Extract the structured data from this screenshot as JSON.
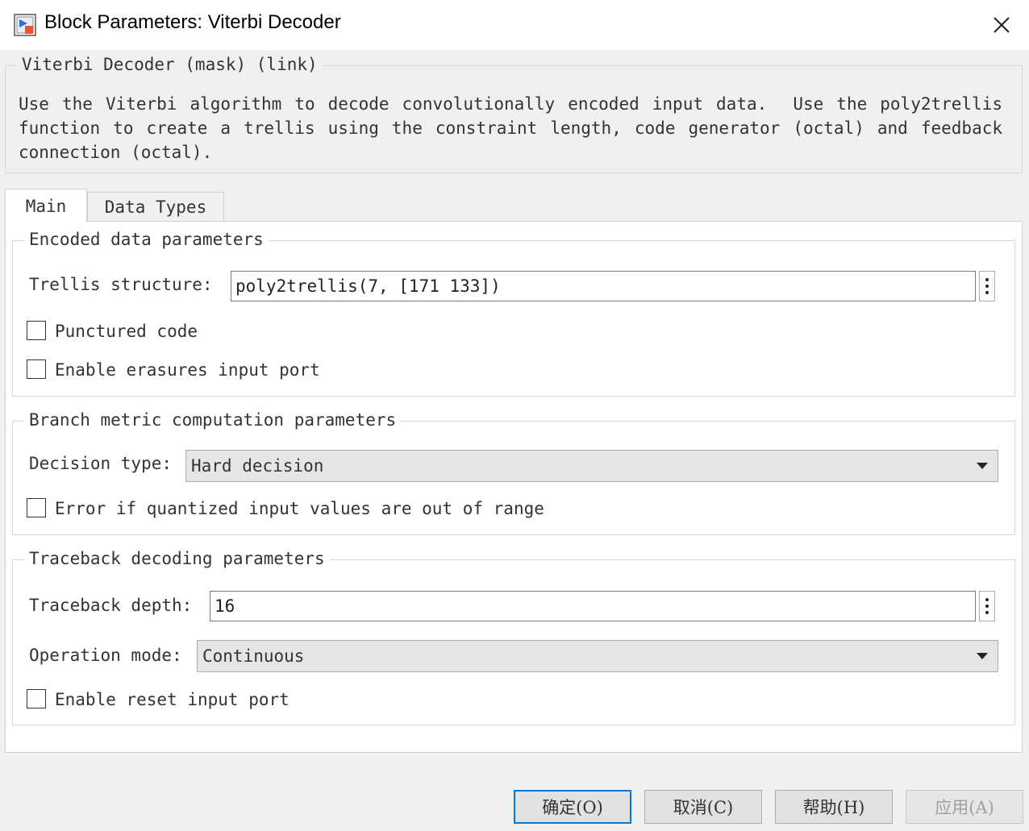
{
  "window": {
    "title": "Block Parameters: Viterbi Decoder",
    "icon": "simulink-block-icon",
    "close_icon": "close-icon"
  },
  "description": {
    "legend": "Viterbi Decoder (mask) (link)",
    "text": "Use the Viterbi algorithm to decode convolutionally encoded input data.  Use the poly2trellis function to create a trellis using the constraint length, code generator (octal) and feedback connection (octal)."
  },
  "tabs": [
    {
      "label": "Main",
      "selected": true
    },
    {
      "label": "Data Types",
      "selected": false
    }
  ],
  "encoded_group": {
    "legend": "Encoded data parameters",
    "trellis_label": "Trellis structure:",
    "trellis_value": "poly2trellis(7, [171 133])",
    "punctured_label": "Punctured code",
    "punctured_checked": false,
    "erasures_label": "Enable erasures input port",
    "erasures_checked": false
  },
  "branch_group": {
    "legend": "Branch metric computation parameters",
    "decision_label": "Decision type:",
    "decision_value": "Hard decision",
    "error_label": "Error if quantized input values are out of range",
    "error_checked": false
  },
  "traceback_group": {
    "legend": "Traceback decoding parameters",
    "depth_label": "Traceback depth:",
    "depth_value": "16",
    "mode_label": "Operation mode:",
    "mode_value": "Continuous",
    "reset_label": "Enable reset input port",
    "reset_checked": false
  },
  "buttons": {
    "ok": "确定(O)",
    "cancel": "取消(C)",
    "help": "帮助(H)",
    "apply": "应用(A)"
  },
  "colors": {
    "accent": "#0078d7",
    "dialog_bg": "#f0f0f0",
    "panel_bg": "#ffffff"
  }
}
